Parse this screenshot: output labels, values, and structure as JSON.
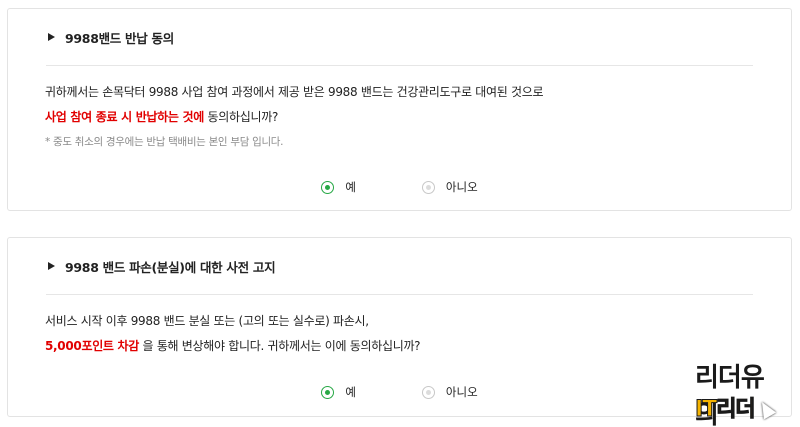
{
  "section1": {
    "title": "9988밴드 반납 동의",
    "line1": "귀하께서는 손목닥터 9988 사업 참여 과정에서 제공 받은 9988 밴드는 건강관리도구로 대여된 것으로",
    "line2_emphasis": "사업 참여 종료 시 반납하는 것에",
    "line2_rest": " 동의하십니까?",
    "note": "* 중도 취소의 경우에는 반납 택배비는 본인 부담 입니다.",
    "options": [
      {
        "label": "예",
        "selected": true
      },
      {
        "label": "아니오",
        "selected": false
      }
    ]
  },
  "section2": {
    "title": "9988 밴드 파손(분실)에 대한 사전 고지",
    "line1": "서비스 시작 이후 9988 밴드 분실 또는 (고의 또는 실수로) 파손시,",
    "line2_emphasis": "5,000포인트 차감",
    "line2_rest": " 을 통해 변상해야 합니다. 귀하께서는 이에 동의하십니까?",
    "options": [
      {
        "label": "예",
        "selected": true
      },
      {
        "label": "아니오",
        "selected": false
      }
    ]
  },
  "watermark": {
    "top": "리더유의",
    "bottom": "IT리더"
  },
  "colors": {
    "accent_green": "#27a845",
    "emphasis_red": "#e10000"
  }
}
